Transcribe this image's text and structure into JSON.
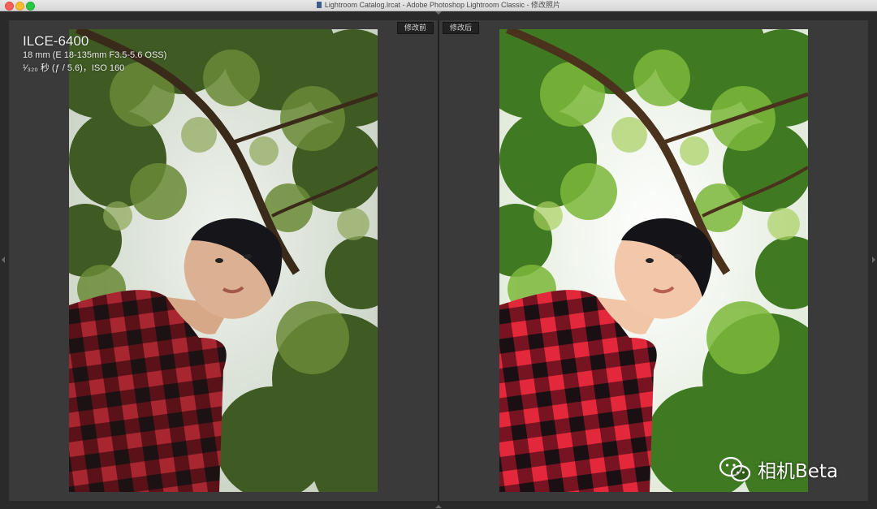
{
  "window": {
    "title": "Lightroom Catalog.lrcat - Adobe Photoshop Lightroom Classic - 修改照片",
    "colors": {
      "close": "#fc5f57",
      "minimize": "#fdbc2e",
      "maximize": "#28c940"
    }
  },
  "compare": {
    "before_label": "修改前",
    "after_label": "修改后"
  },
  "exif": {
    "camera": "ILCE-6400",
    "lens": "18 mm (E 18-135mm F3.5-5.6 OSS)",
    "exposure": "¹⁄₃₂₀ 秒 (ƒ / 5.6)，ISO 160"
  },
  "watermark": {
    "text": "相机Beta",
    "icon": "wechat-icon"
  }
}
